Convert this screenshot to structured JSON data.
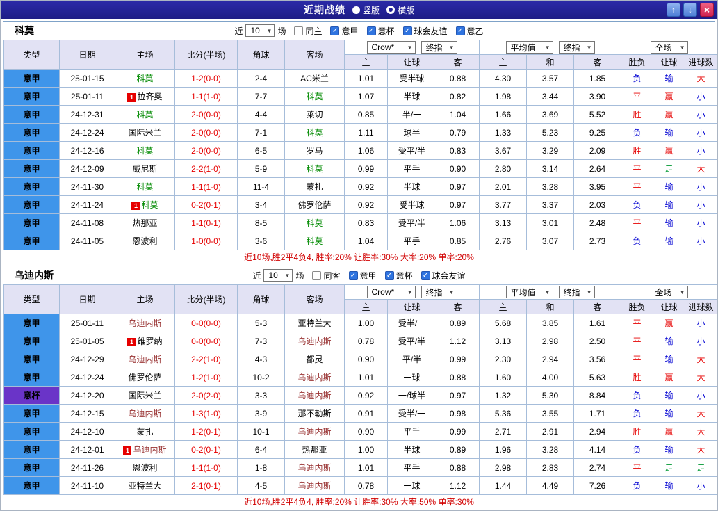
{
  "titlebar": {
    "title": "近期战绩",
    "radios": [
      {
        "label": "竖版",
        "selected": true
      },
      {
        "label": "横版",
        "selected": false
      }
    ],
    "up_icon": "↑",
    "down_icon": "↓",
    "close_icon": "×"
  },
  "colors": {
    "red": "#e60000",
    "blue": "#0000d2",
    "green": "#009933",
    "score": "#e60000",
    "summary": "#d10000",
    "league": "#3f95ea",
    "cup": "#6a34c8",
    "team1": "#008a00",
    "team2": "#993333"
  },
  "sections": [
    {
      "team": "科莫",
      "team_color_key": "team1",
      "near_label": "近",
      "count": "10",
      "games_label": "场",
      "checkboxes": [
        {
          "label": "同主",
          "checked": false
        },
        {
          "label": "意甲",
          "checked": true
        },
        {
          "label": "意杯",
          "checked": true
        },
        {
          "label": "球会友谊",
          "checked": true
        },
        {
          "label": "意乙",
          "checked": true
        }
      ],
      "selects": {
        "bookmaker": "Crow*",
        "book_mode": "终指",
        "average": "平均值",
        "avg_mode": "终指",
        "scope": "全场"
      },
      "columns": [
        "类型",
        "日期",
        "主场",
        "比分(半场)",
        "角球",
        "客场",
        "主",
        "让球",
        "客",
        "主",
        "和",
        "客",
        "胜负",
        "让球",
        "进球数"
      ],
      "rows": [
        {
          "league": "意甲",
          "league_key": "league",
          "date": "25-01-15",
          "home": "科莫",
          "home_focus": true,
          "score": "1-2(0-0)",
          "corners": "2-4",
          "away": "AC米兰",
          "away_focus": false,
          "h": "1.01",
          "hcap": "受半球",
          "a": "0.88",
          "avg_h": "4.30",
          "avg_d": "3.57",
          "avg_a": "1.85",
          "res": [
            "负",
            "blue"
          ],
          "hres": [
            "输",
            "blue"
          ],
          "gres": [
            "大",
            "red"
          ]
        },
        {
          "league": "意甲",
          "league_key": "league",
          "date": "25-01-11",
          "home": "拉齐奥",
          "home_focus": false,
          "home_card": "1",
          "score": "1-1(1-0)",
          "corners": "7-7",
          "away": "科莫",
          "away_focus": true,
          "h": "1.07",
          "hcap": "半球",
          "a": "0.82",
          "avg_h": "1.98",
          "avg_d": "3.44",
          "avg_a": "3.90",
          "res": [
            "平",
            "red"
          ],
          "hres": [
            "赢",
            "red"
          ],
          "gres": [
            "小",
            "blue"
          ]
        },
        {
          "league": "意甲",
          "league_key": "league",
          "date": "24-12-31",
          "home": "科莫",
          "home_focus": true,
          "score": "2-0(0-0)",
          "corners": "4-4",
          "away": "莱切",
          "away_focus": false,
          "h": "0.85",
          "hcap": "半/一",
          "a": "1.04",
          "avg_h": "1.66",
          "avg_d": "3.69",
          "avg_a": "5.52",
          "res": [
            "胜",
            "red"
          ],
          "hres": [
            "赢",
            "red"
          ],
          "gres": [
            "小",
            "blue"
          ]
        },
        {
          "league": "意甲",
          "league_key": "league",
          "date": "24-12-24",
          "home": "国际米兰",
          "home_focus": false,
          "score": "2-0(0-0)",
          "corners": "7-1",
          "away": "科莫",
          "away_focus": true,
          "h": "1.11",
          "hcap": "球半",
          "a": "0.79",
          "avg_h": "1.33",
          "avg_d": "5.23",
          "avg_a": "9.25",
          "res": [
            "负",
            "blue"
          ],
          "hres": [
            "输",
            "blue"
          ],
          "gres": [
            "小",
            "blue"
          ]
        },
        {
          "league": "意甲",
          "league_key": "league",
          "date": "24-12-16",
          "home": "科莫",
          "home_focus": true,
          "score": "2-0(0-0)",
          "corners": "6-5",
          "away": "罗马",
          "away_focus": false,
          "h": "1.06",
          "hcap": "受平/半",
          "a": "0.83",
          "avg_h": "3.67",
          "avg_d": "3.29",
          "avg_a": "2.09",
          "res": [
            "胜",
            "red"
          ],
          "hres": [
            "赢",
            "red"
          ],
          "gres": [
            "小",
            "blue"
          ]
        },
        {
          "league": "意甲",
          "league_key": "league",
          "date": "24-12-09",
          "home": "威尼斯",
          "home_focus": false,
          "score": "2-2(1-0)",
          "corners": "5-9",
          "away": "科莫",
          "away_focus": true,
          "h": "0.99",
          "hcap": "平手",
          "a": "0.90",
          "avg_h": "2.80",
          "avg_d": "3.14",
          "avg_a": "2.64",
          "res": [
            "平",
            "red"
          ],
          "hres": [
            "走",
            "green"
          ],
          "gres": [
            "大",
            "red"
          ]
        },
        {
          "league": "意甲",
          "league_key": "league",
          "date": "24-11-30",
          "home": "科莫",
          "home_focus": true,
          "score": "1-1(1-0)",
          "corners": "11-4",
          "away": "蒙扎",
          "away_focus": false,
          "h": "0.92",
          "hcap": "半球",
          "a": "0.97",
          "avg_h": "2.01",
          "avg_d": "3.28",
          "avg_a": "3.95",
          "res": [
            "平",
            "red"
          ],
          "hres": [
            "输",
            "blue"
          ],
          "gres": [
            "小",
            "blue"
          ]
        },
        {
          "league": "意甲",
          "league_key": "league",
          "date": "24-11-24",
          "home": "科莫",
          "home_focus": true,
          "home_card": "1",
          "score": "0-2(0-1)",
          "corners": "3-4",
          "away": "佛罗伦萨",
          "away_focus": false,
          "h": "0.92",
          "hcap": "受半球",
          "a": "0.97",
          "avg_h": "3.77",
          "avg_d": "3.37",
          "avg_a": "2.03",
          "res": [
            "负",
            "blue"
          ],
          "hres": [
            "输",
            "blue"
          ],
          "gres": [
            "小",
            "blue"
          ]
        },
        {
          "league": "意甲",
          "league_key": "league",
          "date": "24-11-08",
          "home": "热那亚",
          "home_focus": false,
          "score": "1-1(0-1)",
          "corners": "8-5",
          "away": "科莫",
          "away_focus": true,
          "h": "0.83",
          "hcap": "受平/半",
          "a": "1.06",
          "avg_h": "3.13",
          "avg_d": "3.01",
          "avg_a": "2.48",
          "res": [
            "平",
            "red"
          ],
          "hres": [
            "输",
            "blue"
          ],
          "gres": [
            "小",
            "blue"
          ]
        },
        {
          "league": "意甲",
          "league_key": "league",
          "date": "24-11-05",
          "home": "恩波利",
          "home_focus": false,
          "score": "1-0(0-0)",
          "corners": "3-6",
          "away": "科莫",
          "away_focus": true,
          "h": "1.04",
          "hcap": "平手",
          "a": "0.85",
          "avg_h": "2.76",
          "avg_d": "3.07",
          "avg_a": "2.73",
          "res": [
            "负",
            "blue"
          ],
          "hres": [
            "输",
            "blue"
          ],
          "gres": [
            "小",
            "blue"
          ]
        }
      ],
      "summary": "近10场,胜2平4负4, 胜率:20% 让胜率:30% 大率:20% 单率:20%"
    },
    {
      "team": "乌迪内斯",
      "team_color_key": "team2",
      "near_label": "近",
      "count": "10",
      "games_label": "场",
      "checkboxes": [
        {
          "label": "同客",
          "checked": false
        },
        {
          "label": "意甲",
          "checked": true
        },
        {
          "label": "意杯",
          "checked": true
        },
        {
          "label": "球会友谊",
          "checked": true
        }
      ],
      "selects": {
        "bookmaker": "Crow*",
        "book_mode": "终指",
        "average": "平均值",
        "avg_mode": "终指",
        "scope": "全场"
      },
      "columns": [
        "类型",
        "日期",
        "主场",
        "比分(半场)",
        "角球",
        "客场",
        "主",
        "让球",
        "客",
        "主",
        "和",
        "客",
        "胜负",
        "让球",
        "进球数"
      ],
      "rows": [
        {
          "league": "意甲",
          "league_key": "league",
          "date": "25-01-11",
          "home": "乌迪内斯",
          "home_focus": true,
          "score": "0-0(0-0)",
          "corners": "5-3",
          "away": "亚特兰大",
          "away_focus": false,
          "h": "1.00",
          "hcap": "受半/一",
          "a": "0.89",
          "avg_h": "5.68",
          "avg_d": "3.85",
          "avg_a": "1.61",
          "res": [
            "平",
            "red"
          ],
          "hres": [
            "赢",
            "red"
          ],
          "gres": [
            "小",
            "blue"
          ]
        },
        {
          "league": "意甲",
          "league_key": "league",
          "date": "25-01-05",
          "home": "维罗纳",
          "home_focus": false,
          "home_card": "1",
          "score": "0-0(0-0)",
          "corners": "7-3",
          "away": "乌迪内斯",
          "away_focus": true,
          "h": "0.78",
          "hcap": "受平/半",
          "a": "1.12",
          "avg_h": "3.13",
          "avg_d": "2.98",
          "avg_a": "2.50",
          "res": [
            "平",
            "red"
          ],
          "hres": [
            "输",
            "blue"
          ],
          "gres": [
            "小",
            "blue"
          ]
        },
        {
          "league": "意甲",
          "league_key": "league",
          "date": "24-12-29",
          "home": "乌迪内斯",
          "home_focus": true,
          "score": "2-2(1-0)",
          "corners": "4-3",
          "away": "都灵",
          "away_focus": false,
          "h": "0.90",
          "hcap": "平/半",
          "a": "0.99",
          "avg_h": "2.30",
          "avg_d": "2.94",
          "avg_a": "3.56",
          "res": [
            "平",
            "red"
          ],
          "hres": [
            "输",
            "blue"
          ],
          "gres": [
            "大",
            "red"
          ]
        },
        {
          "league": "意甲",
          "league_key": "league",
          "date": "24-12-24",
          "home": "佛罗伦萨",
          "home_focus": false,
          "score": "1-2(1-0)",
          "corners": "10-2",
          "away": "乌迪内斯",
          "away_focus": true,
          "h": "1.01",
          "hcap": "一球",
          "a": "0.88",
          "avg_h": "1.60",
          "avg_d": "4.00",
          "avg_a": "5.63",
          "res": [
            "胜",
            "red"
          ],
          "hres": [
            "赢",
            "red"
          ],
          "gres": [
            "大",
            "red"
          ]
        },
        {
          "league": "意杯",
          "league_key": "cup",
          "date": "24-12-20",
          "home": "国际米兰",
          "home_focus": false,
          "score": "2-0(2-0)",
          "corners": "3-3",
          "away": "乌迪内斯",
          "away_focus": true,
          "h": "0.92",
          "hcap": "一/球半",
          "a": "0.97",
          "avg_h": "1.32",
          "avg_d": "5.30",
          "avg_a": "8.84",
          "res": [
            "负",
            "blue"
          ],
          "hres": [
            "输",
            "blue"
          ],
          "gres": [
            "小",
            "blue"
          ]
        },
        {
          "league": "意甲",
          "league_key": "league",
          "date": "24-12-15",
          "home": "乌迪内斯",
          "home_focus": true,
          "score": "1-3(1-0)",
          "corners": "3-9",
          "away": "那不勒斯",
          "away_focus": false,
          "h": "0.91",
          "hcap": "受半/一",
          "a": "0.98",
          "avg_h": "5.36",
          "avg_d": "3.55",
          "avg_a": "1.71",
          "res": [
            "负",
            "blue"
          ],
          "hres": [
            "输",
            "blue"
          ],
          "gres": [
            "大",
            "red"
          ]
        },
        {
          "league": "意甲",
          "league_key": "league",
          "date": "24-12-10",
          "home": "蒙扎",
          "home_focus": false,
          "score": "1-2(0-1)",
          "corners": "10-1",
          "away": "乌迪内斯",
          "away_focus": true,
          "h": "0.90",
          "hcap": "平手",
          "a": "0.99",
          "avg_h": "2.71",
          "avg_d": "2.91",
          "avg_a": "2.94",
          "res": [
            "胜",
            "red"
          ],
          "hres": [
            "赢",
            "red"
          ],
          "gres": [
            "大",
            "red"
          ]
        },
        {
          "league": "意甲",
          "league_key": "league",
          "date": "24-12-01",
          "home": "乌迪内斯",
          "home_focus": true,
          "home_card": "1",
          "score": "0-2(0-1)",
          "corners": "6-4",
          "away": "热那亚",
          "away_focus": false,
          "h": "1.00",
          "hcap": "半球",
          "a": "0.89",
          "avg_h": "1.96",
          "avg_d": "3.28",
          "avg_a": "4.14",
          "res": [
            "负",
            "blue"
          ],
          "hres": [
            "输",
            "blue"
          ],
          "gres": [
            "大",
            "red"
          ]
        },
        {
          "league": "意甲",
          "league_key": "league",
          "date": "24-11-26",
          "home": "恩波利",
          "home_focus": false,
          "score": "1-1(1-0)",
          "corners": "1-8",
          "away": "乌迪内斯",
          "away_focus": true,
          "h": "1.01",
          "hcap": "平手",
          "a": "0.88",
          "avg_h": "2.98",
          "avg_d": "2.83",
          "avg_a": "2.74",
          "res": [
            "平",
            "red"
          ],
          "hres": [
            "走",
            "green"
          ],
          "gres": [
            "走",
            "green"
          ]
        },
        {
          "league": "意甲",
          "league_key": "league",
          "date": "24-11-10",
          "home": "亚特兰大",
          "home_focus": false,
          "score": "2-1(0-1)",
          "corners": "4-5",
          "away": "乌迪内斯",
          "away_focus": true,
          "h": "0.78",
          "hcap": "一球",
          "a": "1.12",
          "avg_h": "1.44",
          "avg_d": "4.49",
          "avg_a": "7.26",
          "res": [
            "负",
            "blue"
          ],
          "hres": [
            "输",
            "blue"
          ],
          "gres": [
            "小",
            "blue"
          ]
        }
      ],
      "summary": "近10场,胜2平4负4, 胜率:20% 让胜率:30% 大率:50% 单率:30%"
    }
  ]
}
